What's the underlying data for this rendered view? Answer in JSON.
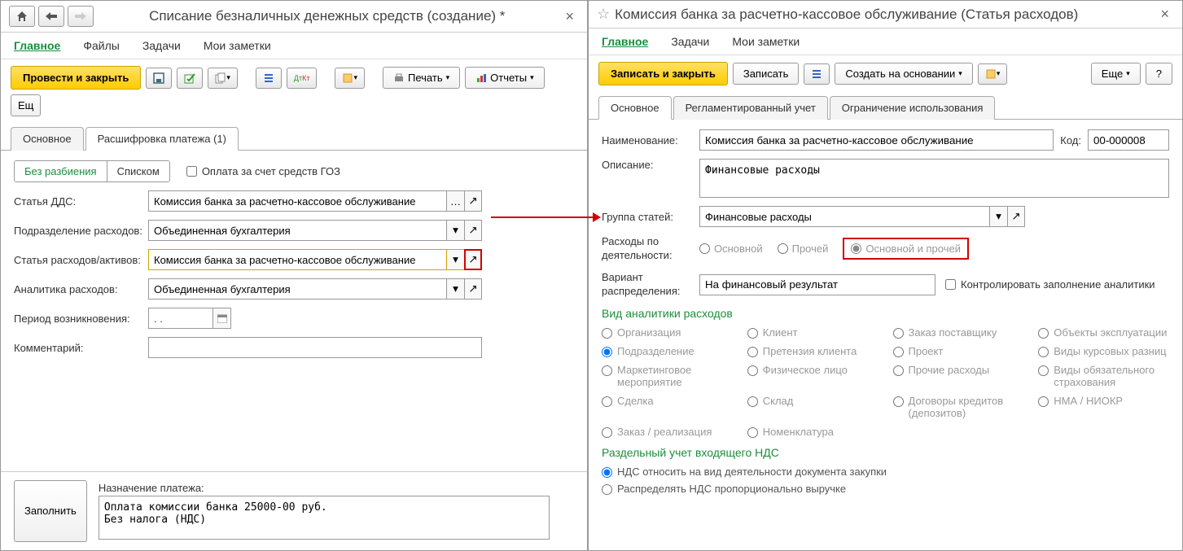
{
  "left": {
    "title": "Списание безналичных денежных средств (создание) *",
    "menu": {
      "main": "Главное",
      "files": "Файлы",
      "tasks": "Задачи",
      "notes": "Мои заметки"
    },
    "toolbar": {
      "post_close": "Провести и закрыть",
      "print": "Печать",
      "reports": "Отчеты",
      "more": "Ещ"
    },
    "tabs": {
      "main": "Основное",
      "detail": "Расшифровка платежа (1)"
    },
    "toggle": {
      "no_split": "Без разбиения",
      "list": "Списком"
    },
    "goz_label": "Оплата за счет средств ГОЗ",
    "fields": {
      "dds_label": "Статья ДДС:",
      "dds_value": "Комиссия банка за расчетно-кассовое обслуживание",
      "dept_label": "Подразделение расходов:",
      "dept_value": "Объединенная бухгалтерия",
      "expense_label": "Статья расходов/активов:",
      "expense_value": "Комиссия банка за расчетно-кассовое обслуживание",
      "analytics_label": "Аналитика расходов:",
      "analytics_value": "Объединенная бухгалтерия",
      "period_label": "Период возникновения:",
      "period_value": ".   .",
      "comment_label": "Комментарий:"
    },
    "footer": {
      "fill_btn": "Заполнить",
      "purpose_label": "Назначение платежа:",
      "purpose_text": "Оплата комиссии банка 25000-00 руб.\nБез налога (НДС)"
    }
  },
  "right": {
    "title": "Комиссия банка за расчетно-кассовое обслуживание (Статья расходов)",
    "menu": {
      "main": "Главное",
      "tasks": "Задачи",
      "notes": "Мои заметки"
    },
    "toolbar": {
      "save_close": "Записать и закрыть",
      "save": "Записать",
      "create_based": "Создать на основании",
      "more": "Еще",
      "help": "?"
    },
    "tabs": {
      "main": "Основное",
      "reg": "Регламентированный учет",
      "limit": "Ограничение использования"
    },
    "fields": {
      "name_label": "Наименование:",
      "name_value": "Комиссия банка за расчетно-кассовое обслуживание",
      "code_label": "Код:",
      "code_value": "00-000008",
      "desc_label": "Описание:",
      "desc_value": "Финансовые расходы",
      "group_label": "Группа статей:",
      "group_value": "Финансовые расходы",
      "activity_label": "Расходы по деятельности:",
      "act_main": "Основной",
      "act_other": "Прочей",
      "act_both": "Основной и прочей",
      "variant_label": "Вариант распределения:",
      "variant_value": "На финансовый результат",
      "control_label": "Контролировать заполнение аналитики"
    },
    "sections": {
      "analytics_head": "Вид аналитики расходов",
      "vat_head": "Раздельный учет входящего НДС"
    },
    "analytics": {
      "org": "Организация",
      "client": "Клиент",
      "supplier_order": "Заказ поставщику",
      "objects": "Объекты эксплуатации",
      "dept": "Подразделение",
      "claim": "Претензия клиента",
      "project": "Проект",
      "fx": "Виды курсовых разниц",
      "marketing": "Маркетинговое мероприятие",
      "person": "Физическое лицо",
      "other_exp": "Прочие расходы",
      "insurance": "Виды обязательного страхования",
      "deal": "Сделка",
      "warehouse": "Склад",
      "credits": "Договоры кредитов (депозитов)",
      "nma": "НМА / НИОКР",
      "order_real": "Заказ / реализация",
      "nomen": "Номенклатура"
    },
    "vat": {
      "opt1": "НДС относить на вид деятельности документа закупки",
      "opt2": "Распределять НДС пропорционально выручке"
    }
  }
}
